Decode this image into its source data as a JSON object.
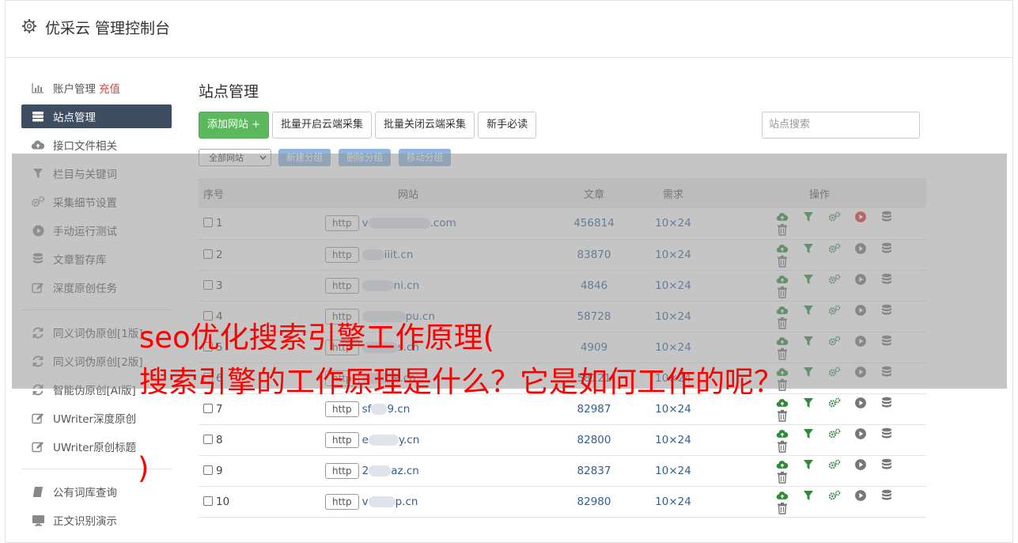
{
  "app_title": "优采云 管理控制台",
  "sidebar": {
    "items": [
      {
        "label": "账户管理",
        "badge": "充值",
        "icon": "bar-chart-icon"
      },
      {
        "label": "站点管理",
        "icon": "server-icon",
        "active": true
      },
      {
        "label": "接口文件相关",
        "icon": "cloud-upload-icon"
      },
      {
        "label": "栏目与关键词",
        "icon": "filter-icon"
      },
      {
        "label": "采集细节设置",
        "icon": "gears-icon"
      },
      {
        "label": "手动运行测试",
        "icon": "play-circle-icon"
      },
      {
        "label": "文章暂存库",
        "icon": "database-icon"
      },
      {
        "label": "深度原创任务",
        "icon": "edit-icon"
      }
    ],
    "items2": [
      {
        "label": "同义词伪原创[1版]",
        "icon": "refresh-icon"
      },
      {
        "label": "同义词伪原创[2版]",
        "icon": "refresh-icon"
      },
      {
        "label": "智能伪原创[AI版]",
        "icon": "refresh-icon"
      },
      {
        "label": "UWriter深度原创",
        "icon": "edit-icon"
      },
      {
        "label": "UWriter原创标题",
        "icon": "edit-icon"
      }
    ],
    "items3": [
      {
        "label": "公有词库查询",
        "icon": "book-icon"
      },
      {
        "label": "正文识别演示",
        "icon": "monitor-icon"
      }
    ]
  },
  "main": {
    "title": "站点管理",
    "buttons": {
      "add_site": "添加网站 +",
      "batch_open": "批量开启云端采集",
      "batch_close": "批量关闭云端采集",
      "guide": "新手必读"
    },
    "search_placeholder": "站点搜索",
    "group_select": "全部网站",
    "group_buttons": {
      "new": "新建分组",
      "delete": "删除分组",
      "move": "移动分组"
    },
    "table": {
      "headers": {
        "no": "序号",
        "site": "网站",
        "articles": "文章",
        "demand": "需求",
        "ops": "操作"
      },
      "rows": [
        {
          "no": "1",
          "prefix": "http",
          "a": "v",
          "b": ".com",
          "articles": "456814",
          "demand": "10×24",
          "running": true
        },
        {
          "no": "2",
          "prefix": "http",
          "a": "",
          "b": "iiit.cn",
          "articles": "83870",
          "demand": "10×24",
          "running": false
        },
        {
          "no": "3",
          "prefix": "http",
          "a": "",
          "b": "ni.cn",
          "articles": "4846",
          "demand": "10×24",
          "running": false
        },
        {
          "no": "4",
          "prefix": "http",
          "a": "",
          "b": "pu.cn",
          "articles": "58728",
          "demand": "10×24",
          "running": false
        },
        {
          "no": "5",
          "prefix": "http",
          "a": "",
          "b": "s.cn",
          "articles": "4909",
          "demand": "10×24",
          "running": false
        },
        {
          "no": "6",
          "prefix": "http",
          "a": "",
          "b": "k.cn",
          "articles": "58121",
          "demand": "10×24",
          "running": false
        },
        {
          "no": "7",
          "prefix": "http",
          "a": "sf",
          "b": "9.cn",
          "articles": "82987",
          "demand": "10×24",
          "running": false
        },
        {
          "no": "8",
          "prefix": "http",
          "a": "e",
          "b": "y.cn",
          "articles": "82800",
          "demand": "10×24",
          "running": false
        },
        {
          "no": "9",
          "prefix": "http",
          "a": "2",
          "b": "az.cn",
          "articles": "82837",
          "demand": "10×24",
          "running": false
        },
        {
          "no": "10",
          "prefix": "http",
          "a": "v",
          "b": "p.cn",
          "articles": "82980",
          "demand": "10×24",
          "running": false
        }
      ]
    }
  },
  "headline": {
    "line1": "seo优化搜索引擎工作原理(",
    "line2": "搜索引擎的工作原理是什么？它是如何工作的呢？",
    "line3": ")"
  },
  "colors": {
    "accent_green": "#5cb85c",
    "sidebar_active": "#3f4d63",
    "headline": "#ff0000",
    "link": "#2f5f98"
  }
}
